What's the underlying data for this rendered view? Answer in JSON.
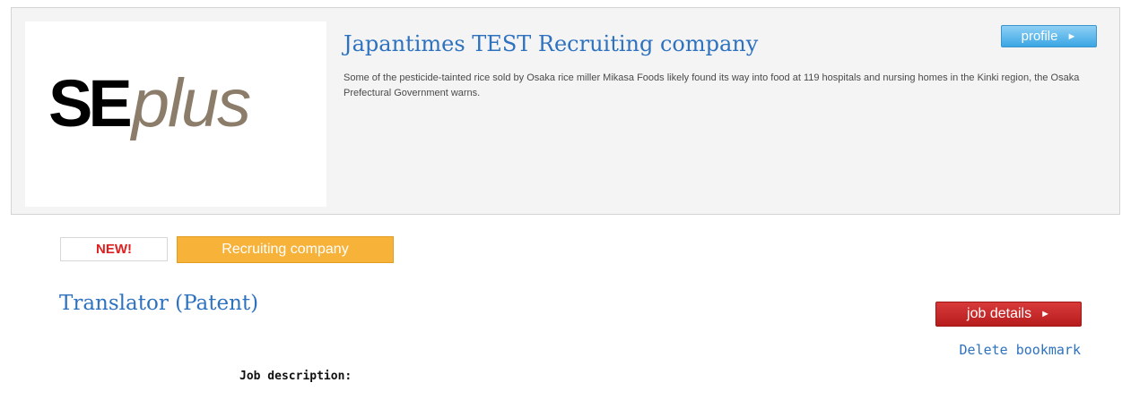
{
  "company": {
    "logo": {
      "prefix": "SE",
      "suffix": "plus"
    },
    "name": "Japantimes TEST Recruiting company",
    "description": "Some of the pesticide-tainted rice sold by Osaka rice miller Mikasa Foods likely found its way into food at 119 hospitals and nursing homes in the Kinki region, the Osaka Prefectural Government warns.",
    "profile_button_label": "profile",
    "profile_button_arrow": "►"
  },
  "badges": {
    "new_label": "NEW!",
    "recruiting_label": "Recruiting company"
  },
  "job": {
    "title": "Translator (Patent)",
    "details_button_label": "job details",
    "details_button_arrow": "►",
    "delete_bookmark_label": "Delete bookmark",
    "description_label": "Job description:"
  },
  "colors": {
    "link_blue": "#2e72bf",
    "profile_button": "#3aa6e4",
    "recruiting_badge": "#f6b239",
    "new_badge_text": "#e02020",
    "job_details_button": "#c62828"
  }
}
